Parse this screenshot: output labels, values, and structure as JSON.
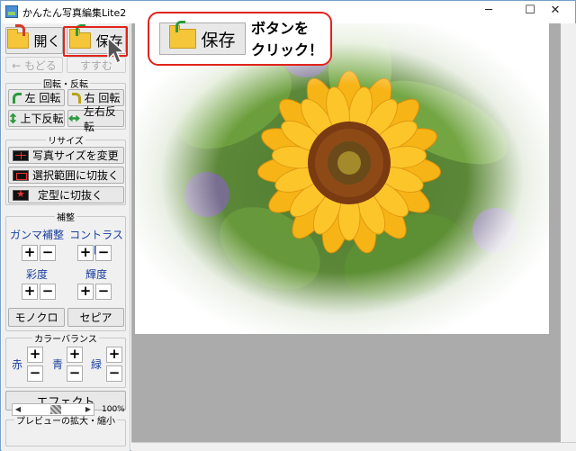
{
  "window": {
    "title": "かんたん写真編集Lite2",
    "minimize_glyph": "─",
    "maximize_glyph": "☐",
    "close_glyph": "✕"
  },
  "toolbar": {
    "open_label": "開く",
    "save_label": "保存",
    "back_label": "← もどる",
    "forward_label": "すすむ"
  },
  "rotate_group": {
    "title": "回転・反転",
    "rotate_left": "左 回転",
    "rotate_right": "右 回転",
    "flip_vertical": "上下反転",
    "flip_horizontal": "左右反転"
  },
  "resize_group": {
    "title": "リサイズ",
    "change_size": "写真サイズを変更",
    "crop_selection": "選択範囲に切抜く",
    "crop_preset": "定型に切抜く"
  },
  "correction_group": {
    "title": "補整",
    "gamma": "ガンマ補整",
    "contrast": "コントラスト",
    "saturation": "彩度",
    "brightness": "輝度",
    "monochrome": "モノクロ",
    "sepia": "セピア",
    "plus": "+",
    "minus": "−"
  },
  "color_balance_group": {
    "title": "カラーバランス",
    "red": "赤",
    "green": "青",
    "blue": "緑"
  },
  "effect_label": "エフェクト",
  "preview_group": {
    "title": "プレビューの拡大・縮小",
    "zoom_value": "100%"
  },
  "callout": {
    "button_label": "保存",
    "text_line1": "ボタンを",
    "text_line2": "クリック！"
  },
  "colors": {
    "accent_red": "#e2231a",
    "label_blue": "#1a3fa0",
    "canvas_gray": "#ababab"
  }
}
